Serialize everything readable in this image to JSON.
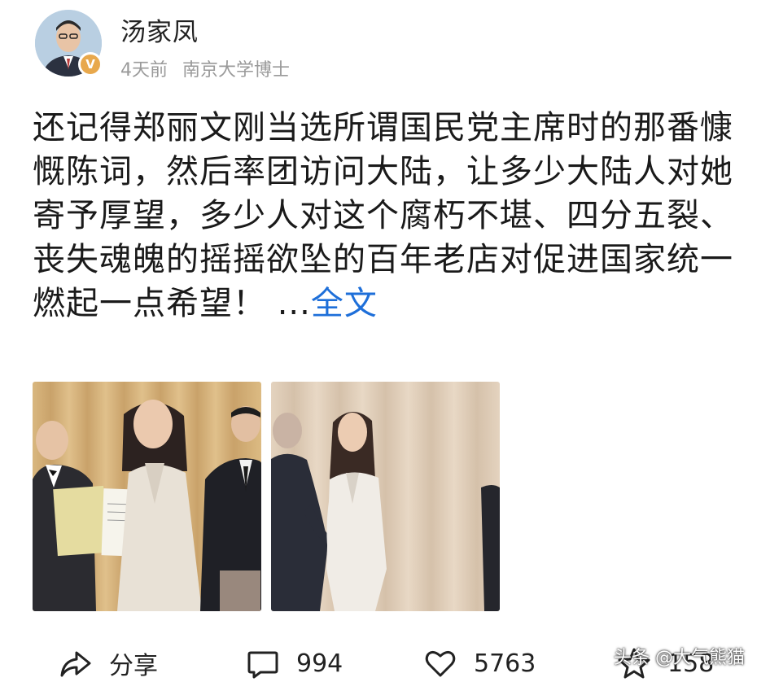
{
  "author": {
    "name": "汤家凤",
    "time": "4天前",
    "title": "南京大学博士",
    "badge": "V"
  },
  "post": {
    "text": "还记得郑丽文刚当选所谓国民党主席时的那番慷慨陈词，然后率团访问大陆，让多少大陆人对她寄予厚望，多少人对这个腐朽不堪、四分五裂、丧失魂魄的摇摇欲坠的百年老店对促进国家统一燃起一点希望！",
    "ellipsis": "...",
    "more_label": "全文"
  },
  "images": [
    {
      "name": "photo-1"
    },
    {
      "name": "photo-2"
    }
  ],
  "actions": {
    "share_label": "分享",
    "comment_count": "994",
    "like_count": "5763",
    "fav_count": "158"
  },
  "watermark": "头条 @大气熊猫",
  "colors": {
    "link": "#1e6fd9",
    "meta": "#9a9a9a",
    "badge": "#e8a84c"
  },
  "icons": {
    "share": "share-icon",
    "comment": "comment-icon",
    "like": "heart-icon",
    "fav": "star-icon"
  }
}
